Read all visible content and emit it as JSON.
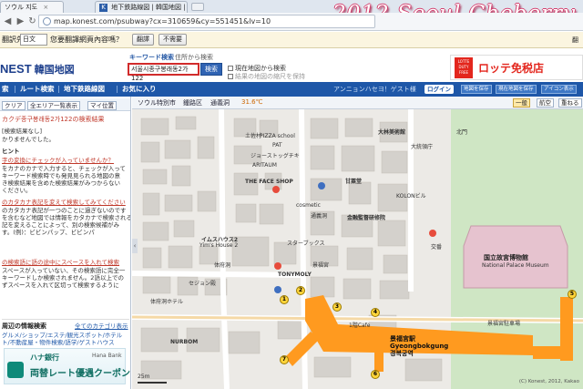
{
  "browser": {
    "tabs": [
      {
        "label": "ソウル 지도",
        "active": false
      },
      {
        "label": "地下鉄路線図 | 韓国地図 |",
        "active": true
      }
    ],
    "url": "map.konest.com/psubway?cx=310659&cy=551451&lv=10",
    "overlay_title": "2012 Seoul Cheberry",
    "translate_bar": {
      "prefix": "翻訳先",
      "language": "日文",
      "question": "您要翻譯網頁內容嗎？",
      "translate_btn": "翻譯",
      "no_btn": "不需要",
      "right_text": "翻譯"
    }
  },
  "site": {
    "logo": "NEST",
    "logo_sub": "韓国地図",
    "keyword_tab": "キーワード検索",
    "address_tab": "住所から検索",
    "search_value": "서울시종구봉래동2가122",
    "search_button": "検索",
    "checkbox_current": "現在地図から検索",
    "checkbox_disabled": "結果の地図の縮尺を保持",
    "ad_badge": "LOTTE DUTY FREE",
    "ad_text": "ロッテ免税店"
  },
  "nav": {
    "items": [
      "索",
      "ルート検索",
      "地下鉄路線図",
      "お気に入り"
    ],
    "user_text": "アンニョンハセヨ！ゲスト様",
    "login": "ログイン",
    "tools": [
      "地図を保存",
      "現在地図を保存",
      "アイコン表示"
    ]
  },
  "left_panel": {
    "toolbar": [
      "クリア",
      "全エリア一覧表示",
      "マイ位置"
    ],
    "result_title": "カクデ종구봉래동2가122の検索結果",
    "subtitle": "[検索結果なし]",
    "no_results": "かりませんでした。",
    "hint_heading": "ヒント",
    "hint1_link": "字の変換にチェックが入っていませんか？",
    "hint1_body": [
      "をカナのカナで入力すると、チェックが入って",
      "キーワード検索時でも発見見られる地図の意",
      "き検索結果を含めた検索結果がみつからない",
      "ください。"
    ],
    "hint2_link": "のカタカナ表記を変えて検索してみてください",
    "hint2_body": [
      "のカタカナ表記が一つのことに過ぎないのです",
      "を含むなど地図では情報をカタカナで検索される場",
      "記を変えることによって、別の検索候補がみ",
      "す。(例)：ビビンパップ、ビビンパ"
    ],
    "hint3_link": "の検索語に語の途中にスペースを入れて検索",
    "hint3_body": [
      "スペースが入っていない、その検索語に完全一",
      "キーワードしか検索されません。2語以上での",
      "ずスペースを入れて区切って検索するように"
    ],
    "info_heading": "周辺の情報検索",
    "info_link": "全てのカテゴリ表示",
    "info_items": [
      "グルメ/ショップ/エステ/観光スポット/ホテル",
      "ト/不動産屋・物件検索/語学/ゲストハウス"
    ],
    "bank_name": "Hana Bank",
    "bank_line1": "ハナ銀行",
    "bank_line2": "両替レート優遇クーポン"
  },
  "map_toolbar": {
    "items": [
      "ソウル特別市",
      "鍾路区",
      "通義洞"
    ],
    "weather": "31.6℃",
    "modes": [
      "一般",
      "航空",
      "重ねる"
    ]
  },
  "map": {
    "labels": [
      "土佐村",
      "PIZZA school",
      "PAT",
      "ジョーストッグチキ",
      "ARITAUM",
      "THE FACE SHOP",
      "cosmetic",
      "イムスハウス2",
      "Yim's House 2",
      "スターブックス",
      "体府洞",
      "景福宮",
      "TONYMOLY",
      "通義洞",
      "セジョン殿",
      "KOLONビル",
      "大林美術館",
      "甘粟堂",
      "金融監督研修院",
      "国立故宮博物館",
      "National Palace Museum",
      "NURBOM",
      "1階Cafe",
      "交番",
      "北門",
      "大統領庁",
      "景福宮駐車場",
      "体府洞ホテル"
    ],
    "station_ko": "景福宮駅",
    "station_en": "Gyeongbokgung",
    "station_hangul": "경복궁역",
    "exits": [
      "1",
      "2",
      "3",
      "4",
      "5",
      "6",
      "7"
    ],
    "scale_label": "25m",
    "copyright": "(C) Konest, 2012, Kakao"
  }
}
